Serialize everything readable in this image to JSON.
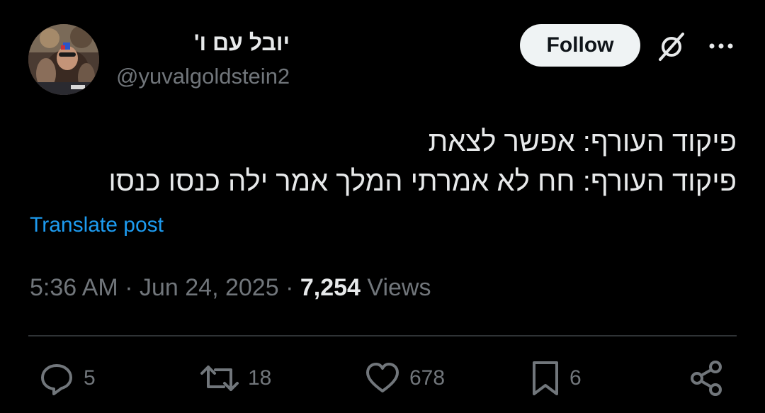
{
  "author": {
    "display_name": "יובל עם ו'",
    "handle": "@yuvalgoldstein2",
    "avatar_icon": "avatar"
  },
  "header": {
    "follow_label": "Follow",
    "grok_icon": "grok-icon",
    "more_icon": "more-icon"
  },
  "tweet": {
    "lines": [
      "פיקוד העורף: אפשר לצאת",
      "פיקוד העורף: חח לא אמרתי המלך אמר ילה כנסו כנסו"
    ],
    "translate_label": "Translate post"
  },
  "meta": {
    "time": "5:36 AM",
    "separator": "·",
    "date": "Jun 24, 2025",
    "views_count": "7,254",
    "views_label": "Views"
  },
  "actions": {
    "replies": "5",
    "reposts": "18",
    "likes": "678",
    "bookmarks": "6"
  },
  "colors": {
    "background": "#000000",
    "text": "#e7e9ea",
    "secondary": "#71767b",
    "link": "#1d9bf0",
    "divider": "#2f3336"
  }
}
